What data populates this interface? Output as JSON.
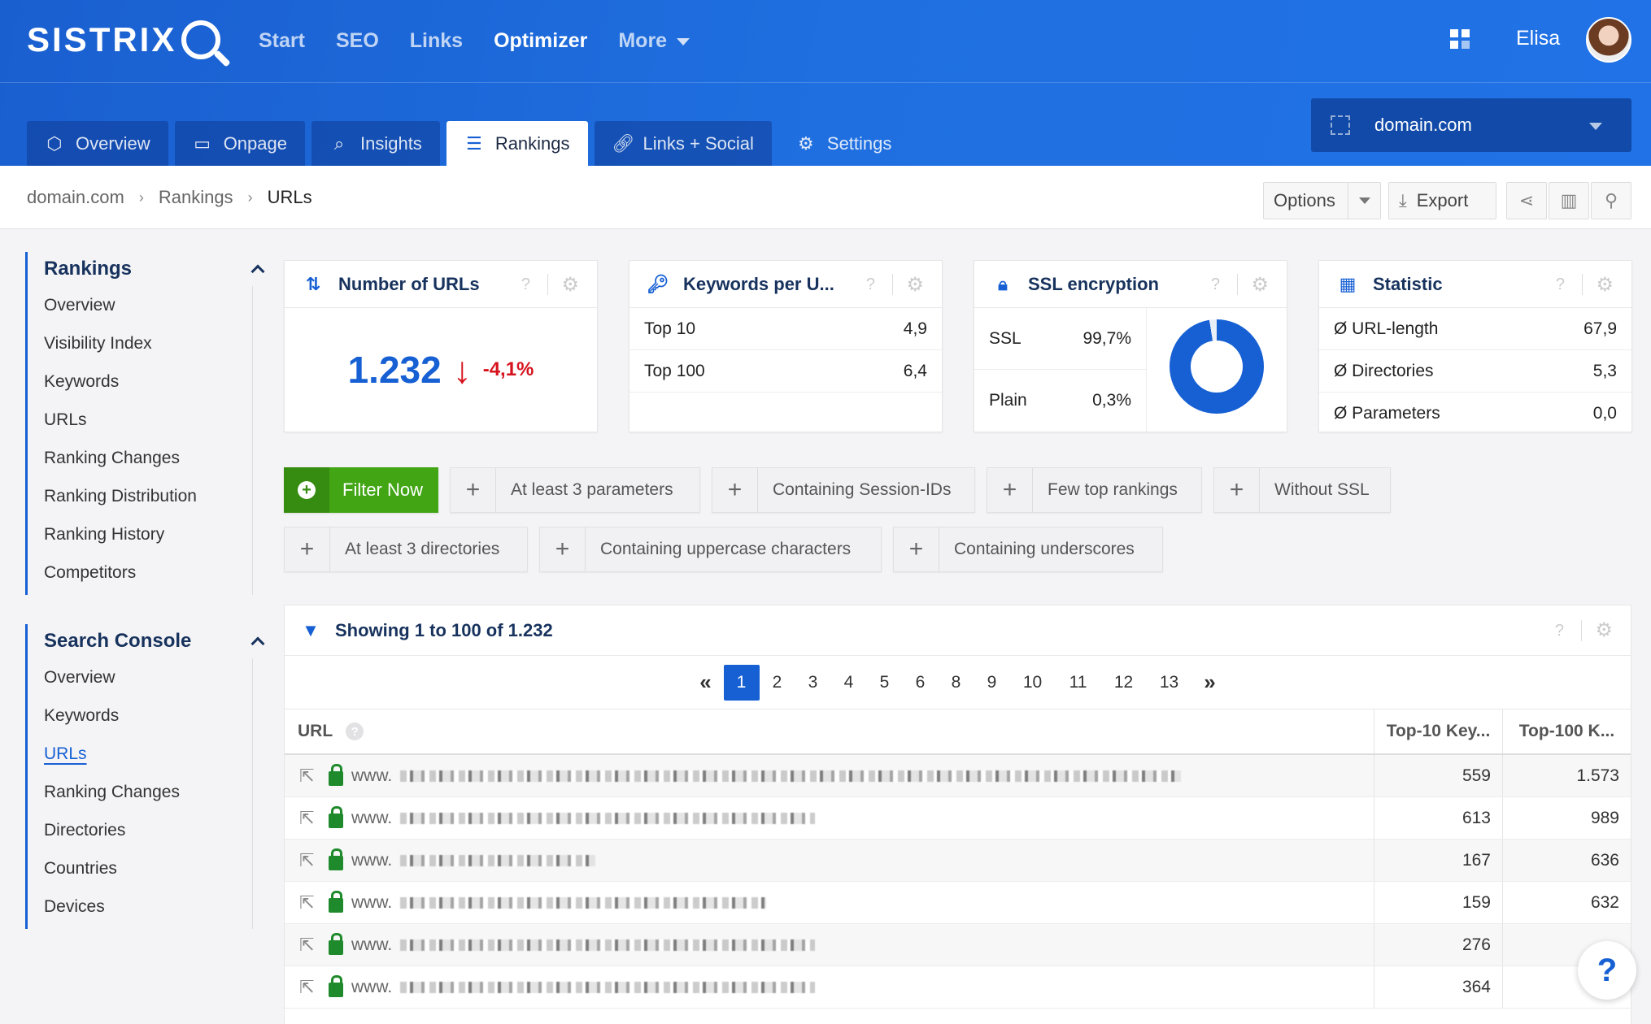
{
  "brand": {
    "name": "SISTRIX"
  },
  "topnav": {
    "items": [
      "Start",
      "SEO",
      "Links",
      "Optimizer",
      "More"
    ],
    "active": "Optimizer",
    "username": "Elisa"
  },
  "subtabs": [
    {
      "label": "Overview",
      "icon": "cube-icon"
    },
    {
      "label": "Onpage",
      "icon": "monitor-icon"
    },
    {
      "label": "Insights",
      "icon": "search-icon"
    },
    {
      "label": "Rankings",
      "icon": "list-icon"
    },
    {
      "label": "Links + Social",
      "icon": "link-icon"
    },
    {
      "label": "Settings",
      "icon": "gear-icon"
    }
  ],
  "project_select": {
    "value": "domain.com"
  },
  "breadcrumb": [
    "domain.com",
    "Rankings",
    "URLs"
  ],
  "toolbar": {
    "options_label": "Options",
    "export_label": "Export"
  },
  "sidebar": {
    "rankings": {
      "title": "Rankings",
      "items": [
        "Overview",
        "Visibility Index",
        "Keywords",
        "URLs",
        "Ranking Changes",
        "Ranking Distribution",
        "Ranking History",
        "Competitors"
      ]
    },
    "search_console": {
      "title": "Search Console",
      "items": [
        "Overview",
        "Keywords",
        "URLs",
        "Ranking Changes",
        "Directories",
        "Countries",
        "Devices"
      ],
      "active": "URLs"
    }
  },
  "boxes": {
    "urls": {
      "title": "Number of URLs",
      "value": "1.232",
      "change": "-4,1%"
    },
    "keywords": {
      "title": "Keywords per U...",
      "rows": [
        {
          "label": "Top 10",
          "value": "4,9"
        },
        {
          "label": "Top 100",
          "value": "6,4"
        }
      ]
    },
    "ssl": {
      "title": "SSL encryption",
      "rows": [
        {
          "label": "SSL",
          "value": "99,7%"
        },
        {
          "label": "Plain",
          "value": "0,3%"
        }
      ],
      "ssl_share": 0.997
    },
    "statistic": {
      "title": "Statistic",
      "rows": [
        {
          "label": "Ø URL-length",
          "value": "67,9"
        },
        {
          "label": "Ø Directories",
          "value": "5,3"
        },
        {
          "label": "Ø Parameters",
          "value": "0,0"
        }
      ]
    }
  },
  "filters": {
    "filter_now_label": "Filter Now",
    "chips": [
      "At least 3 parameters",
      "Containing Session-IDs",
      "Few top rankings",
      "Without SSL",
      "At least 3 directories",
      "Containing uppercase characters",
      "Containing underscores"
    ]
  },
  "table": {
    "title": "Showing 1 to 100 of 1.232",
    "pages": [
      "«",
      "1",
      "2",
      "3",
      "4",
      "5",
      "6",
      "8",
      "9",
      "10",
      "11",
      "12",
      "13",
      "»"
    ],
    "active_page": "1",
    "columns": [
      "URL",
      "Top-10 Key...",
      "Top-100 K..."
    ],
    "rows": [
      {
        "url": "www.",
        "top10": "559",
        "top100": "1.573"
      },
      {
        "url": "www.",
        "top10": "613",
        "top100": "989"
      },
      {
        "url": "www.",
        "top10": "167",
        "top100": "636"
      },
      {
        "url": "www.",
        "top10": "159",
        "top100": "632"
      },
      {
        "url": "www.",
        "top10": "276",
        "top100": ""
      },
      {
        "url": "www.",
        "top10": "364",
        "top100": "5..."
      }
    ]
  },
  "help": {
    "label": "?"
  }
}
